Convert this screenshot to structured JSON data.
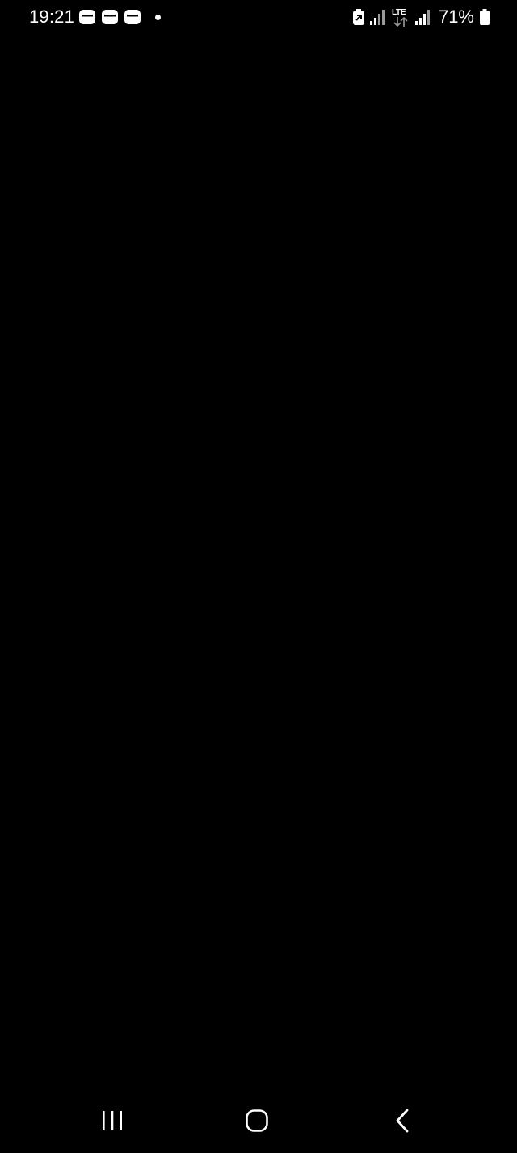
{
  "status_bar": {
    "time": "19:21",
    "notification_icons": [
      "app-notification-icon",
      "app-notification-icon",
      "app-notification-icon"
    ],
    "more_notifications_icon": "dot-icon",
    "lte_label": "LTE",
    "battery_percent": "71%"
  },
  "screen": {
    "background_color": "#000000"
  },
  "nav_bar": {
    "recents_icon": "recents-icon",
    "home_icon": "home-icon",
    "back_icon": "back-icon"
  }
}
